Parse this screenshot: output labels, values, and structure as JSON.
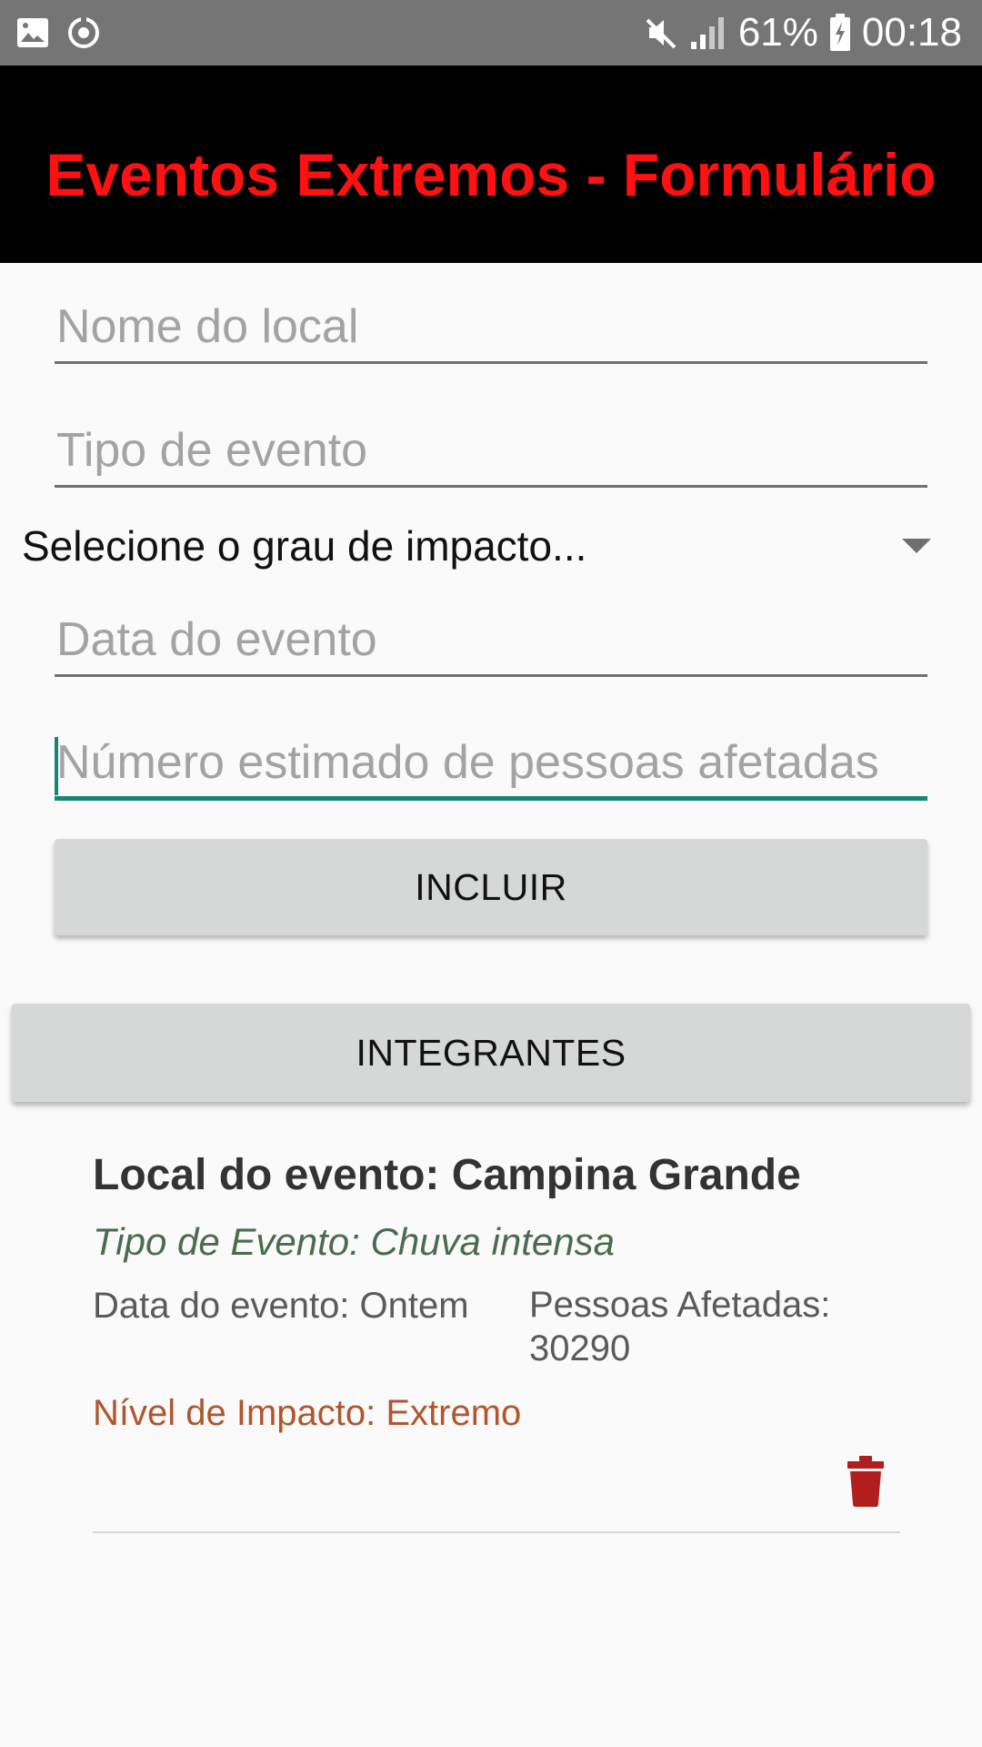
{
  "status_bar": {
    "battery": "61%",
    "time": "00:18",
    "icons": [
      "image-icon",
      "sync-icon",
      "mute-icon",
      "signal-icon",
      "battery-charging-icon"
    ]
  },
  "app_bar": {
    "title": "Eventos Extremos - Formulário",
    "title_color": "#ff1111",
    "background": "#000000"
  },
  "form": {
    "nome_local_placeholder": "Nome do local",
    "tipo_evento_placeholder": "Tipo de evento",
    "impacto_spinner_label": "Selecione o grau de impacto...",
    "data_evento_placeholder": "Data do evento",
    "pessoas_placeholder": "Número estimado de pessoas afetadas",
    "focused_accent": "#168579",
    "incluir_label": "INCLUIR"
  },
  "integrantes_label": "INTEGRANTES",
  "events": [
    {
      "local": "Local do evento: Campina Grande",
      "tipo": "Tipo de Evento: Chuva intensa",
      "data": "Data do evento: Ontem",
      "pessoas": "Pessoas Afetadas: 30290",
      "nivel": "Nível de Impacto: Extremo",
      "nivel_color": "#b0562e",
      "delete_icon": "trash-icon",
      "delete_color": "#b01e1e"
    }
  ]
}
